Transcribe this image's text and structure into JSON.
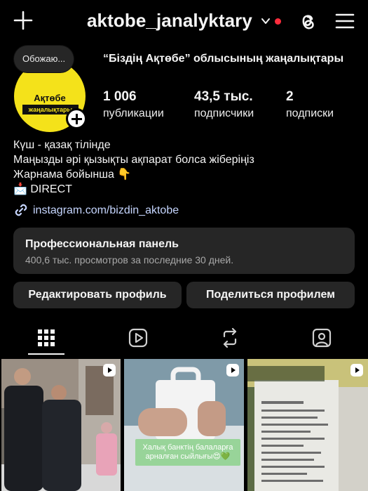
{
  "header": {
    "username": "aktobe_janalyktary",
    "icons": [
      "add-icon",
      "chevron-down-icon",
      "threads-icon",
      "menu-icon"
    ],
    "notification_dot_color": "#ff2d3d"
  },
  "profile": {
    "note": "Обожаю...",
    "avatar_title": "Ақтөбе",
    "avatar_subtitle": "жаңалықтары",
    "display_name": "“Біздің Ақтөбе” облысының жаңалықтары",
    "stats": [
      {
        "value": "1 006",
        "label": "публикации"
      },
      {
        "value": "43,5 тыс.",
        "label": "подписчики"
      },
      {
        "value": "2",
        "label": "подписки"
      }
    ]
  },
  "bio": {
    "lines": [
      "Күш - қазақ тілінде",
      "Маңызды әрі қызықты ақпарат болса жіберіңіз",
      "Жарнама бойынша 👇",
      "📩 DIRECT"
    ],
    "link": "instagram.com/bizdin_aktobe",
    "link_color": "#c6d6ff"
  },
  "dashboard": {
    "title": "Профессиональная панель",
    "subtitle": "400,6 тыс. просмотров за последние 30 дней."
  },
  "actions": {
    "edit_label": "Редактировать профиль",
    "share_label": "Поделиться профилем"
  },
  "tabs": [
    "grid-icon",
    "reels-icon",
    "reposts-icon",
    "tagged-icon"
  ],
  "posts": [
    {
      "type": "reel",
      "caption": ""
    },
    {
      "type": "reel",
      "caption": "Халық банктің балаларға арналған сыйлығы😍💚"
    },
    {
      "type": "reel",
      "caption": ""
    }
  ]
}
